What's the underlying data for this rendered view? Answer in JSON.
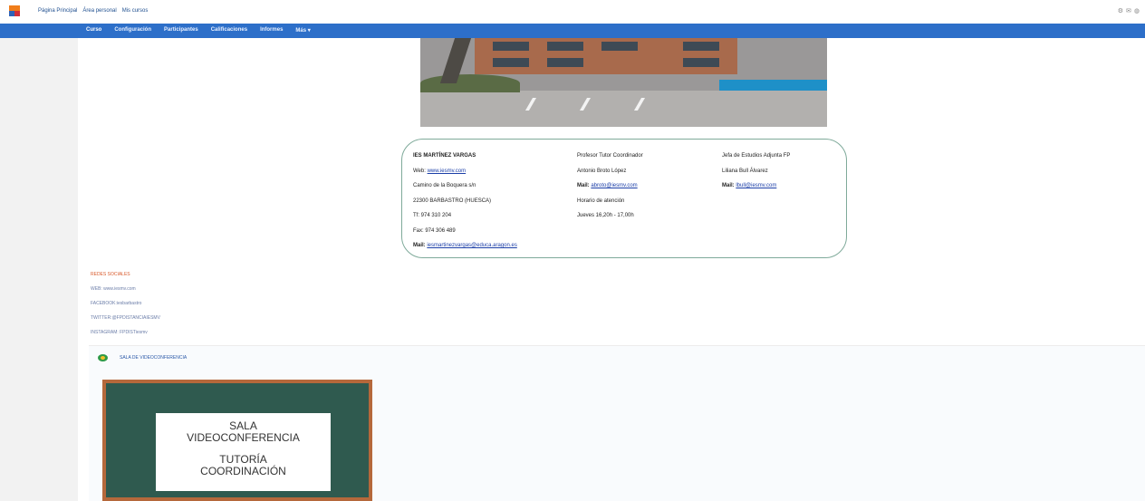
{
  "topbar": {
    "links": [
      "Página Principal",
      "Área personal",
      "Mis cursos"
    ],
    "icons": [
      "settings-icon",
      "message-icon",
      "user-icon"
    ]
  },
  "nav": {
    "items": [
      "Curso",
      "Configuración",
      "Participantes",
      "Calificaciones",
      "Informes",
      "Más ▾"
    ]
  },
  "info": {
    "colA": {
      "name": "IES MARTÍNEZ VARGAS",
      "web_label": "Web:",
      "web_link": "www.iesmv.com",
      "address": "Camino de la Boquera  s/n",
      "city": "22300 BARBASTRO (HUESCA)",
      "phone": "Tf:  974 310 204",
      "fax": "Fax: 974 306 489",
      "mail_label": "Mail:",
      "mail_link": "iesmartinezvargas@educa.aragon.es"
    },
    "colB": {
      "role": "Profesor Tutor Coordinador",
      "name": "Antonio Broto López",
      "mail_label": "Mail:",
      "mail_link": "abroto@iesmv.com",
      "hours_label": "Horario  de  atención",
      "hours": "Jueves 16,20h - 17,00h"
    },
    "colC": {
      "role": "Jefa de Estudios Adjunta FP",
      "name": "Liliana Bull Álvarez",
      "mail_label": "Mail:",
      "mail_link": "lbull@iesmv.com"
    }
  },
  "redlist": {
    "items": [
      "REDES SOCIALES",
      "WEB: www.iesmv.com",
      "FACEBOOK:iesbarbastro",
      "TWITTER:@FPDISTANCIAIESMV",
      "INSTAGRAM: FPDISTiesmv"
    ]
  },
  "resource": {
    "label": "SALA DE VIDEOCONFERENCIA"
  },
  "board": {
    "line1": "SALA",
    "line2": "VIDEOCONFERENCIA",
    "line3": "TUTORÍA",
    "line4": "COORDINACIÓN"
  }
}
